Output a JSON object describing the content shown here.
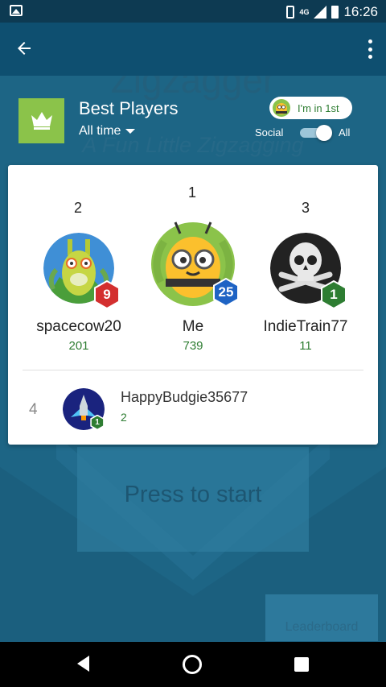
{
  "status_bar": {
    "time": "16:26",
    "network": "4G"
  },
  "game": {
    "title": "Zigzagger",
    "subtitle": "A Fun Little Zigzagging",
    "start_label": "Press to start",
    "leaderboard_label": "Leaderboard"
  },
  "header": {
    "title": "Best Players",
    "time_filter": "All time",
    "chip_label": "I'm in 1st",
    "toggle_left": "Social",
    "toggle_right": "All",
    "toggle_state": "All"
  },
  "podium": [
    {
      "rank": "2",
      "name": "spacecow20",
      "score": "201",
      "level": "9",
      "avatar": "llama-icon"
    },
    {
      "rank": "1",
      "name": "Me",
      "score": "739",
      "level": "25",
      "avatar": "bee-icon"
    },
    {
      "rank": "3",
      "name": "IndieTrain77",
      "score": "11",
      "level": "1",
      "avatar": "skull-icon"
    }
  ],
  "list": [
    {
      "rank": "4",
      "name": "HappyBudgie35677",
      "score": "2",
      "level": "1",
      "avatar": "spaceship-icon"
    }
  ],
  "colors": {
    "app_bar": "#0e4f70",
    "accent_green": "#2e7d32",
    "crown_tile": "#8bc34a",
    "badge_red": "#d32f2f",
    "badge_blue": "#1e63c4",
    "badge_green": "#2e7d32"
  }
}
